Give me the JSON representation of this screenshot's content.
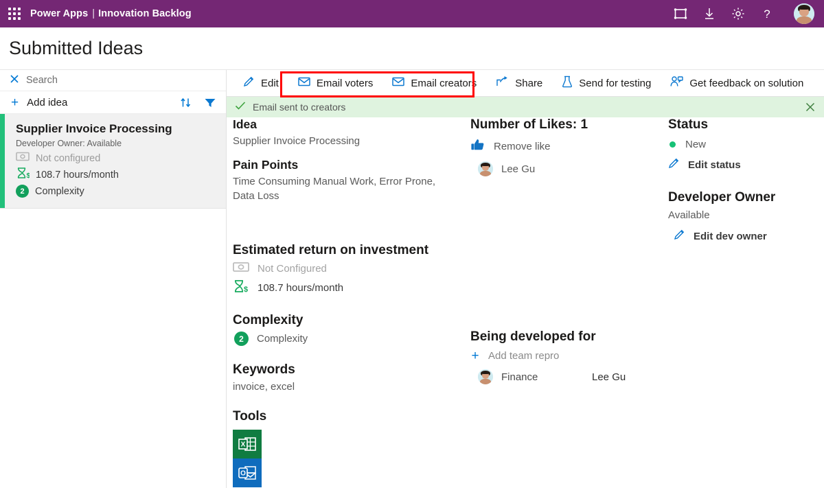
{
  "topbar": {
    "waffle_label": "app-launcher",
    "brand": "Power Apps",
    "separator": "|",
    "app_name": "Innovation Backlog",
    "icons": [
      "fullscreen-icon",
      "download-icon",
      "gear-icon",
      "help-icon"
    ],
    "avatar_label": "user-avatar"
  },
  "page": {
    "title": "Submitted Ideas"
  },
  "sidebar": {
    "search_label": "Search",
    "add_label": "Add idea",
    "sort_icon": "sort-icon",
    "filter_icon": "filter-icon",
    "cards": [
      {
        "title": "Supplier Invoice Processing",
        "owner": "Developer Owner: Available",
        "money": "Not configured",
        "hours": "108.7 hours/month",
        "complexity_badge": "2",
        "complexity_label": "Complexity",
        "accent_color": "#22c07a"
      }
    ]
  },
  "commandbar": {
    "items": [
      {
        "label": "Edit",
        "icon": "pencil-icon"
      },
      {
        "label": "Email voters",
        "icon": "envelope-icon"
      },
      {
        "label": "Email creators",
        "icon": "envelope-icon"
      },
      {
        "label": "Share",
        "icon": "share-icon"
      },
      {
        "label": "Send for testing",
        "icon": "flask-icon"
      },
      {
        "label": "Get feedback on solution",
        "icon": "person-feedback-icon"
      }
    ],
    "highlight_color": "#ff0000"
  },
  "notification": {
    "message": "Email sent to creators",
    "icon": "checkmark-icon",
    "close_icon": "close-icon",
    "background": "#dff3df"
  },
  "details": {
    "idea": {
      "heading": "Idea",
      "value": "Supplier Invoice Processing"
    },
    "pain_points": {
      "heading": "Pain Points",
      "value": "Time Consuming Manual Work, Error Prone, Data Loss"
    },
    "roi": {
      "heading": "Estimated return on investment",
      "money_value": "Not Configured",
      "money_icon": "money-icon",
      "hours_value": "108.7 hours/month",
      "hours_icon": "hourglass-dollar-icon"
    },
    "complexity": {
      "heading": "Complexity",
      "badge": "2",
      "label": "Complexity"
    },
    "keywords": {
      "heading": "Keywords",
      "value": "invoice, excel"
    },
    "tools": {
      "heading": "Tools",
      "items": [
        {
          "name": "excel-icon",
          "letter": "X",
          "color": "#107c41"
        },
        {
          "name": "outlook-icon",
          "letter": "O",
          "color": "#0f6cbd"
        }
      ]
    }
  },
  "likes": {
    "heading": "Number of Likes: 1",
    "action_label": "Remove like",
    "action_icon": "thumbs-up-icon",
    "voters": [
      {
        "name": "Lee Gu"
      }
    ]
  },
  "developed_for": {
    "heading": "Being developed for",
    "add_label": "Add team repro",
    "rows": [
      {
        "team": "Finance",
        "person": "Lee Gu"
      }
    ]
  },
  "status": {
    "heading": "Status",
    "value": "New",
    "dot_color": "#17c176",
    "edit_label": "Edit status",
    "edit_icon": "pencil-icon"
  },
  "developer_owner": {
    "heading": "Developer Owner",
    "value": "Available",
    "edit_label": "Edit dev owner",
    "edit_icon": "pencil-icon"
  }
}
